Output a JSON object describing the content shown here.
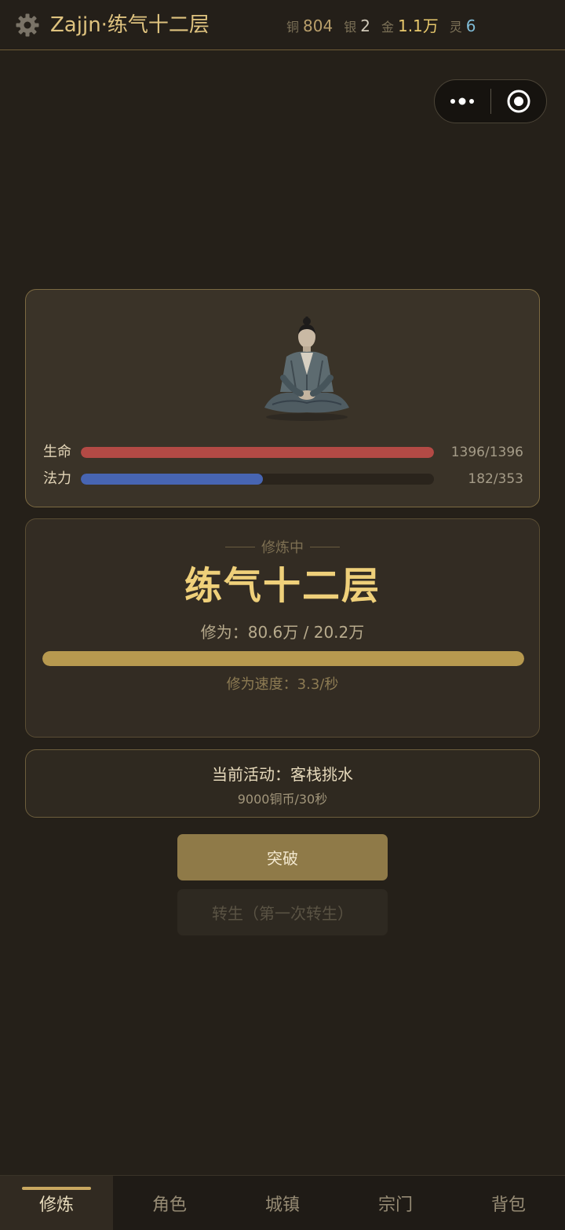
{
  "header": {
    "title": "Zajjn·练气十二层",
    "settings_icon": "gear-icon",
    "currencies": [
      {
        "key": "铜",
        "value": "804",
        "color": "#b99f6b"
      },
      {
        "key": "银",
        "value": "2",
        "color": "#cfc8b8"
      },
      {
        "key": "金",
        "value": "1.1万",
        "color": "#e8c86c"
      },
      {
        "key": "灵",
        "value": "6",
        "color": "#7fbbd6"
      }
    ]
  },
  "capsule": {
    "more_icon": "more-dots-icon",
    "close_icon": "target-circle-icon"
  },
  "character": {
    "avatar_icon": "meditating-cultivator-icon",
    "hp": {
      "label": "生命",
      "value": "1396/1396",
      "ratio": 1.0
    },
    "mp": {
      "label": "法力",
      "value": "182/353",
      "ratio": 0.5156
    }
  },
  "cultivation": {
    "status": "修炼中",
    "realm": "练气十二层",
    "xp": "修为：80.6万 / 20.2万",
    "progress_ratio": 1.0,
    "speed": "修为速度：3.3/秒"
  },
  "activity": {
    "title": "当前活动：客栈挑水",
    "reward": "9000铜币/30秒"
  },
  "buttons": {
    "breakthrough": "突破",
    "rebirth": "转生（第一次转生）"
  },
  "nav": {
    "items": [
      "修炼",
      "角色",
      "城镇",
      "宗门",
      "背包"
    ],
    "active": 0
  },
  "colors": {
    "accent": "#dfc37f",
    "hp_bar": "#b34a45",
    "mp_bar": "#4765b2",
    "xp_bar": "#b7994f"
  }
}
